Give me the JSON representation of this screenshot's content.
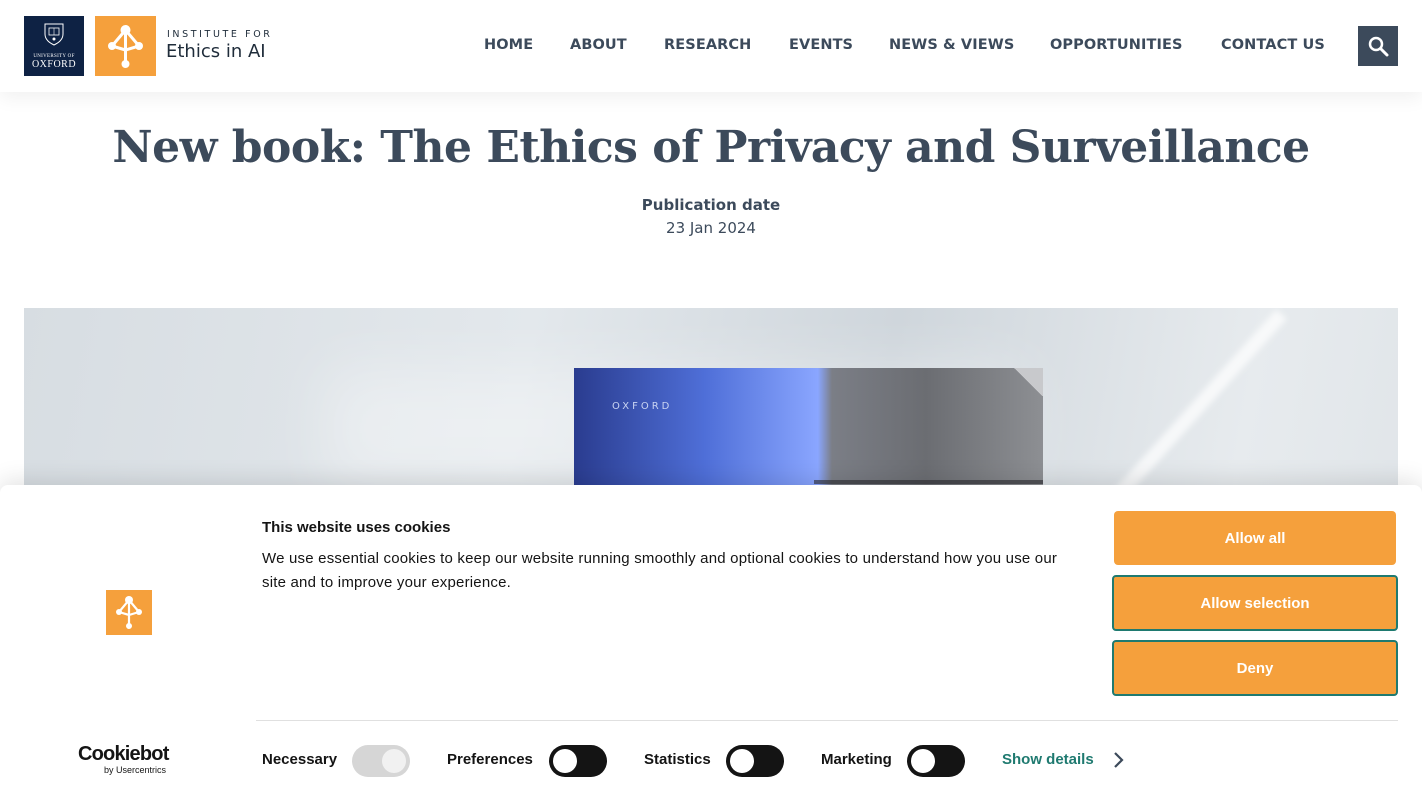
{
  "header": {
    "oxford_logo": {
      "small_text": "UNIVERSITY OF",
      "big_text": "OXFORD"
    },
    "institute": {
      "line1": "INSTITUTE FOR",
      "line2": "Ethics in AI"
    },
    "nav": [
      {
        "label": "HOME"
      },
      {
        "label": "ABOUT"
      },
      {
        "label": "RESEARCH"
      },
      {
        "label": "EVENTS"
      },
      {
        "label": "NEWS & VIEWS"
      },
      {
        "label": "OPPORTUNITIES"
      },
      {
        "label": "CONTACT US"
      }
    ],
    "search_icon": "search-icon"
  },
  "article": {
    "title": "New book: The Ethics of Privacy and Surveillance",
    "pub_label": "Publication date",
    "pub_date": "23 Jan 2024"
  },
  "hero": {
    "book_publisher": "OXFORD"
  },
  "cookie_banner": {
    "title": "This website uses cookies",
    "text": "We use essential cookies to keep our website running smoothly and optional cookies to understand how you use our site and to improve your experience.",
    "buttons": {
      "allow_all": "Allow all",
      "allow_selection": "Allow selection",
      "deny": "Deny"
    },
    "toggles": [
      {
        "label": "Necessary",
        "state": "on-disabled"
      },
      {
        "label": "Preferences",
        "state": "off"
      },
      {
        "label": "Statistics",
        "state": "off"
      },
      {
        "label": "Marketing",
        "state": "off"
      }
    ],
    "show_details": "Show details",
    "cookiebot": {
      "name": "Cookiebot",
      "sub": "by Usercentrics"
    }
  },
  "colors": {
    "accent": "#f5a03c",
    "navy": "#0e2244",
    "text": "#3c4a5b",
    "teal": "#1f7a70"
  }
}
